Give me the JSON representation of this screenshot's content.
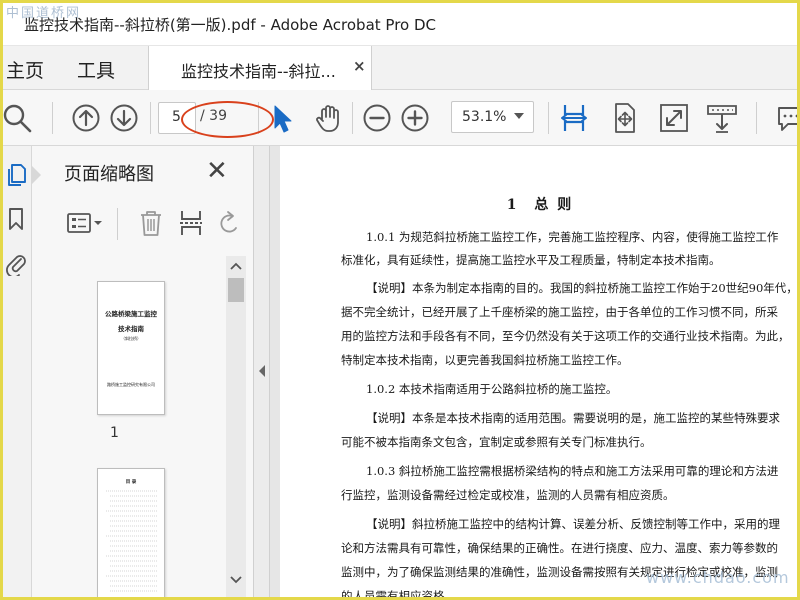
{
  "window": {
    "title": "监控技术指南--斜拉桥(第一版).pdf - Adobe Acrobat Pro DC",
    "watermark_top": "中国道桥网",
    "watermark_bottom": "www.chdao.com"
  },
  "menu": {
    "home": "主页",
    "tools": "工具"
  },
  "tab": {
    "label": "监控技术指南--斜拉...",
    "close": "×"
  },
  "toolbar": {
    "current_page": "5",
    "total_pages": "/ 39",
    "zoom": "53.1%"
  },
  "thumbnail_panel": {
    "title": "页面缩略图",
    "close": "✕",
    "thumb1": {
      "title_line1": "公路桥梁施工监控",
      "title_line2": "技术指南",
      "subtitle": "（斜拉桥）",
      "footer": "路桥施工监控研究有限公司",
      "page_number": "1"
    },
    "thumb2": {
      "title": "目 录"
    }
  },
  "document": {
    "heading": "1　总 则",
    "lines": [
      "1.0.1  为规范斜拉桥施工监控工作，完善施工监控程序、内容，使得施工监控工作",
      "标准化，具有延续性，提高施工监控水平及工程质量，特制定本技术指南。",
      "【说明】本条为制定本指南的目的。我国的斜拉桥施工监控工作始于20世纪90年代，",
      "据不完全统计，已经开展了上千座桥梁的施工监控，由于各单位的工作习惯不同，所采",
      "用的监控方法和手段各有不同，至今仍然没有关于这项工作的交通行业技术指南。为此，",
      "特制定本技术指南，以更完善我国斜拉桥施工监控工作。",
      "1.0.2  本技术指南适用于公路斜拉桥的施工监控。",
      "【说明】本条是本技术指南的适用范围。需要说明的是，施工监控的某些特殊要求",
      "可能不被本指南条文包含，宜制定或参照有关专门标准执行。",
      "1.0.3  斜拉桥施工监控需根据桥梁结构的特点和施工方法采用可靠的理论和方法进",
      "行监控，监测设备需经过检定或校准，监测的人员需有相应资质。",
      "【说明】斜拉桥施工监控中的结构计算、误差分析、反馈控制等工作中，采用的理",
      "论和方法需具有可靠性，确保结果的正确性。在进行挠度、应力、温度、索力等参数的",
      "监测中，为了确保监测结果的准确性，监测设备需按照有关规定进行检定或校准，监测",
      "的人员需有相应资格。"
    ]
  },
  "colors": {
    "accent_blue": "#1a6bc4",
    "highlight_red": "#d9411c",
    "frame_yellow": "#e4d84a"
  }
}
